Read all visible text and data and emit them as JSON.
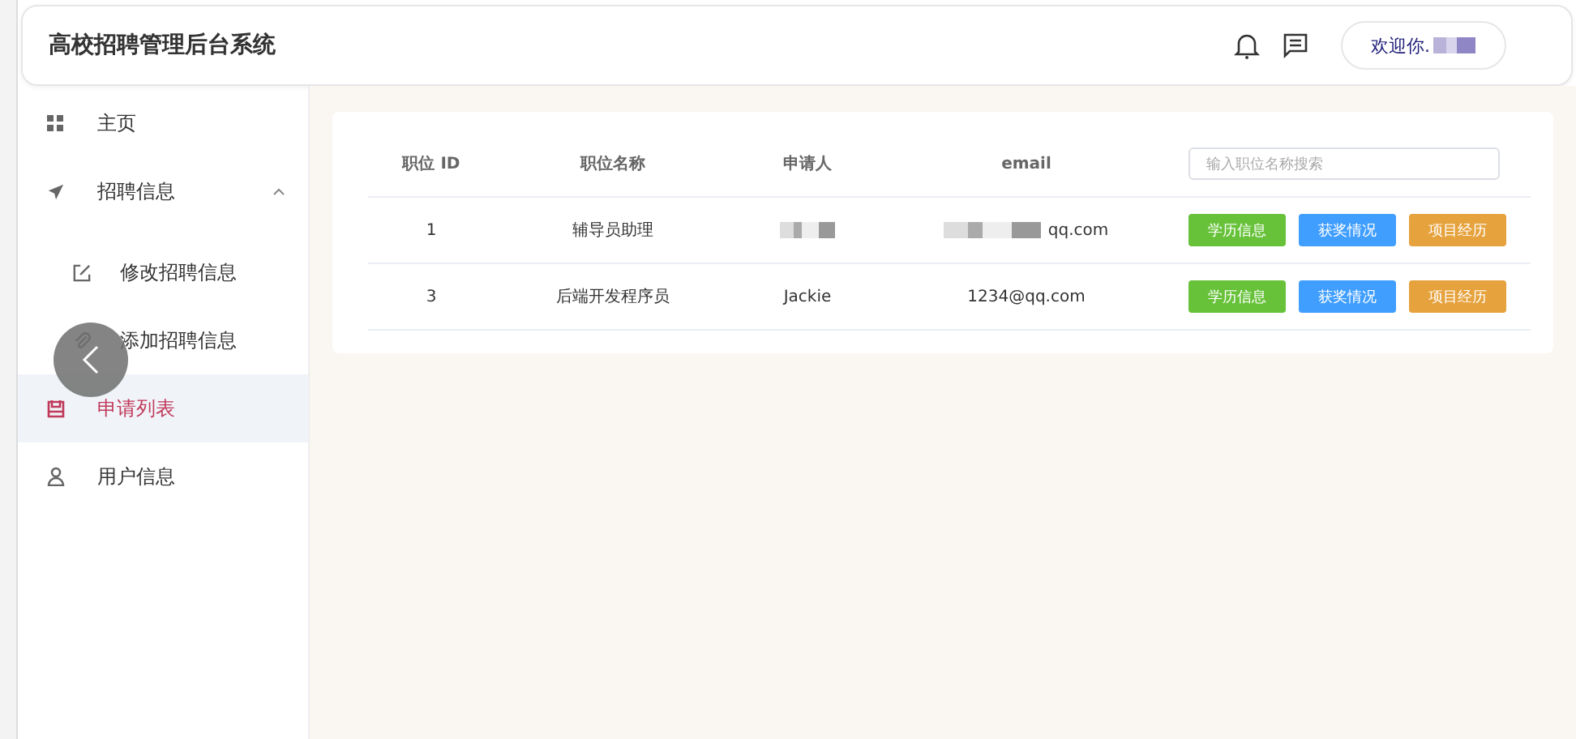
{
  "header": {
    "title": "高校招聘管理后台系统",
    "welcome": "欢迎你."
  },
  "sidebar": {
    "items": [
      {
        "label": "主页",
        "selected": false
      },
      {
        "label": "招聘信息",
        "selected": false,
        "expanded": true,
        "children": [
          {
            "label": "修改招聘信息",
            "selected": false
          },
          {
            "label": "添加招聘信息",
            "selected": false
          }
        ]
      },
      {
        "label": "申请列表",
        "selected": true
      },
      {
        "label": "用户信息",
        "selected": false
      }
    ]
  },
  "table": {
    "columns": [
      "职位 ID",
      "职位名称",
      "申请人",
      "email"
    ],
    "search": {
      "placeholder": "输入职位名称搜索"
    },
    "rows": [
      {
        "cells": [
          "1",
          "辅导员助理",
          "",
          "qq.com"
        ],
        "blurred": true,
        "actions": [
          {
            "label": "学历信息",
            "color": "#67c23a"
          },
          {
            "label": "获奖情况",
            "color": "#409eff"
          },
          {
            "label": "项目经历",
            "color": "#e6a23c"
          }
        ]
      },
      {
        "cells": [
          "3",
          "后端开发程序员",
          "Jackie",
          "1234@qq.com"
        ],
        "blurred": false,
        "actions": [
          {
            "label": "学历信息",
            "color": "#67c23a"
          },
          {
            "label": "获奖情况",
            "color": "#409eff"
          },
          {
            "label": "项目经历",
            "color": "#e6a23c"
          }
        ]
      }
    ]
  }
}
